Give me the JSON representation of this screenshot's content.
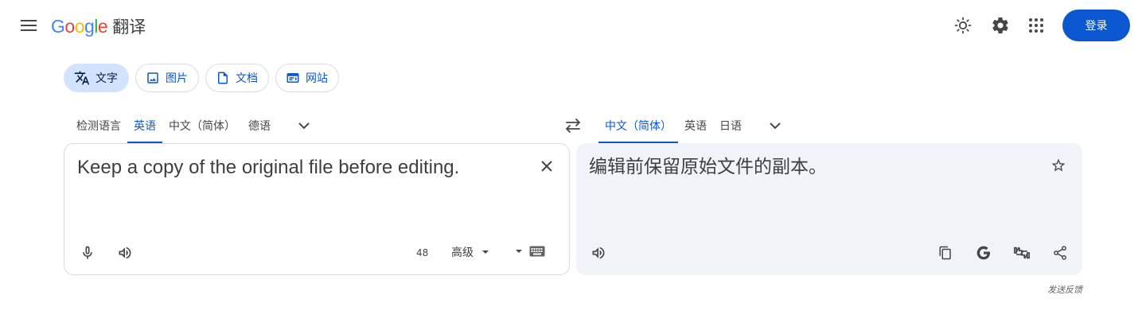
{
  "header": {
    "logo_text": [
      "G",
      "o",
      "o",
      "g",
      "l",
      "e"
    ],
    "product_name": "翻译",
    "signin_label": "登录"
  },
  "modes": [
    {
      "label": "文字",
      "icon": "translate-icon",
      "active": true
    },
    {
      "label": "图片",
      "icon": "image-icon",
      "active": false
    },
    {
      "label": "文档",
      "icon": "document-icon",
      "active": false
    },
    {
      "label": "网站",
      "icon": "website-icon",
      "active": false
    }
  ],
  "source": {
    "languages": [
      "检测语言",
      "英语",
      "中文（简体）",
      "德语"
    ],
    "active_language": "英语",
    "text": "Keep a copy of the original file before editing.",
    "char_count": "48",
    "advanced_label": "高级"
  },
  "target": {
    "languages": [
      "中文（简体）",
      "英语",
      "日语"
    ],
    "active_language": "中文（简体）",
    "text": "编辑前保留原始文件的副本。"
  },
  "footer": {
    "feedback_label": "发送反馈"
  },
  "colors": {
    "accent": "#0b57d0",
    "chip_active_bg": "#d3e3fd",
    "target_bg": "#f0f4f9",
    "icon": "#444746"
  }
}
